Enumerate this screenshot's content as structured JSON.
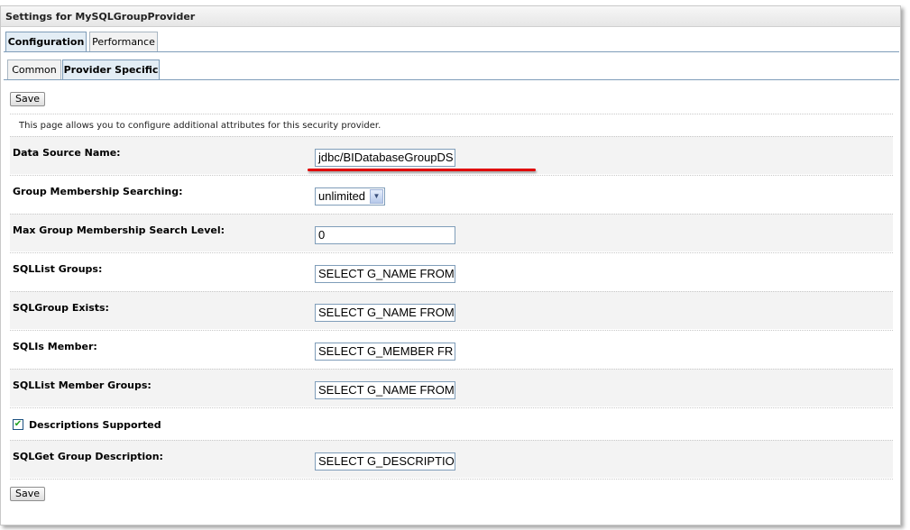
{
  "window": {
    "title": "Settings for MySQLGroupProvider"
  },
  "tabs_main": [
    {
      "label": "Configuration",
      "active": true
    },
    {
      "label": "Performance",
      "active": false
    }
  ],
  "tabs_sub": [
    {
      "label": "Common",
      "active": false
    },
    {
      "label": "Provider Specific",
      "active": true
    }
  ],
  "toolbar": {
    "save_label": "Save"
  },
  "description": "This page allows you to configure additional attributes for this security provider.",
  "fields": {
    "data_source": {
      "label": "Data Source Name:",
      "value": "jdbc/BIDatabaseGroupDS"
    },
    "group_membership": {
      "label": "Group Membership Searching:",
      "value": "unlimited"
    },
    "max_level": {
      "label": "Max Group Membership Search Level:",
      "value": "0"
    },
    "sql_list_groups": {
      "label": "SQLList Groups:",
      "value": "SELECT G_NAME FROM"
    },
    "sql_group_exists": {
      "label": "SQLGroup Exists:",
      "value": "SELECT G_NAME FROM"
    },
    "sql_is_member": {
      "label": "SQLIs Member:",
      "value": "SELECT G_MEMBER FR"
    },
    "sql_list_member_groups": {
      "label": "SQLList Member Groups:",
      "value": "SELECT G_NAME FROM"
    },
    "descriptions_supported": {
      "label": "Descriptions Supported",
      "checked": true
    },
    "sql_get_group_description": {
      "label": "SQLGet Group Description:",
      "value": "SELECT G_DESCRIPTIOI"
    }
  },
  "colors": {
    "annotation_underline": "#e00000",
    "tab_border": "#7f9db9",
    "check": "#21a121"
  },
  "icons": {
    "select_arrow": "chevron-down-icon",
    "checkbox": "checkmark-icon"
  }
}
